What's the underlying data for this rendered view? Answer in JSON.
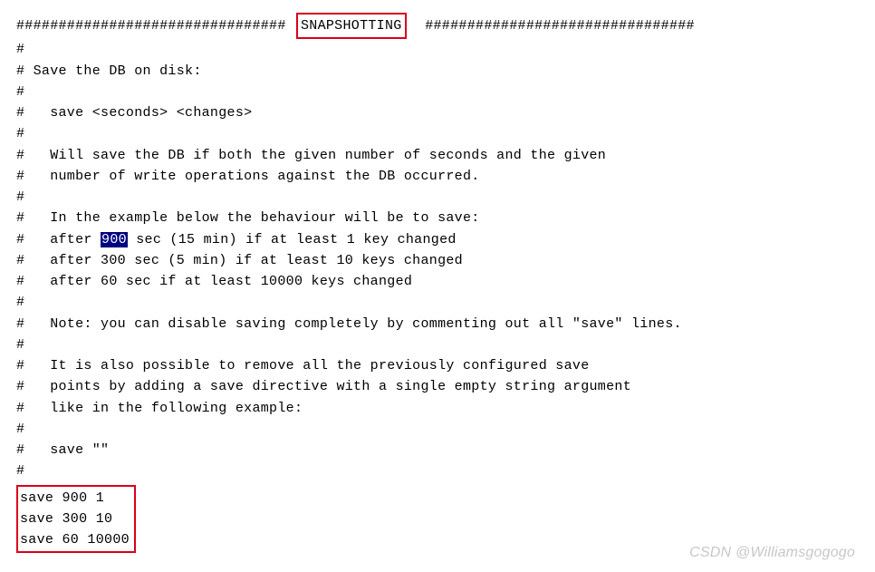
{
  "header": {
    "hashes_left": "################################",
    "title": "SNAPSHOTTING",
    "hashes_right": "################################"
  },
  "comments": {
    "l1": "#",
    "l2": "# Save the DB on disk:",
    "l3": "#",
    "l4": "#   save <seconds> <changes>",
    "l5": "#",
    "l6": "#   Will save the DB if both the given number of seconds and the given",
    "l7": "#   number of write operations against the DB occurred.",
    "l8": "#",
    "l9": "#   In the example below the behaviour will be to save:",
    "l10_pre": "#   after ",
    "l10_sel": "900",
    "l10_post": " sec (15 min) if at least 1 key changed",
    "l11": "#   after 300 sec (5 min) if at least 10 keys changed",
    "l12": "#   after 60 sec if at least 10000 keys changed",
    "l13": "#",
    "l14": "#   Note: you can disable saving completely by commenting out all \"save\" lines.",
    "l15": "#",
    "l16": "#   It is also possible to remove all the previously configured save",
    "l17": "#   points by adding a save directive with a single empty string argument",
    "l18": "#   like in the following example:",
    "l19": "#",
    "l20": "#   save \"\"",
    "l21": "#"
  },
  "saves": {
    "s1": "save 900 1",
    "s2": "save 300 10",
    "s3": "save 60 10000"
  },
  "watermark": "CSDN @Williamsgogogo"
}
